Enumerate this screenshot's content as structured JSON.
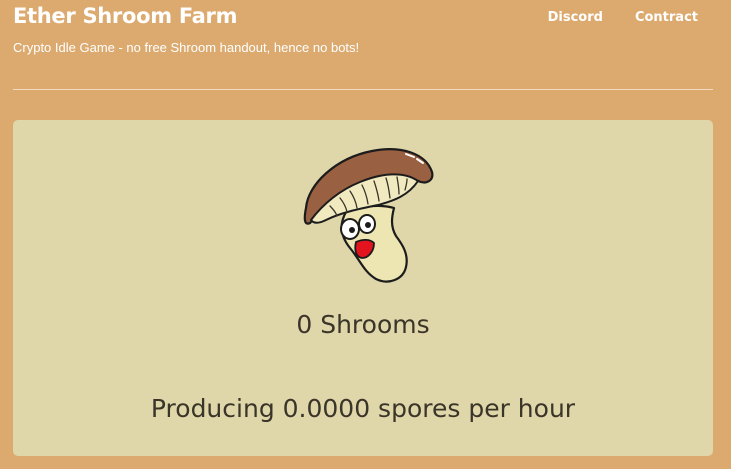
{
  "header": {
    "title": "Ether Shroom Farm",
    "subtitle": "Crypto Idle Game - no free Shroom handout, hence no bots!"
  },
  "nav": {
    "items": [
      {
        "label": "Discord"
      },
      {
        "label": "Contract"
      }
    ]
  },
  "main": {
    "mascot_icon": "mushroom-mascot-icon",
    "shroom_count": "0 Shrooms",
    "production": "Producing 0.0000 spores per hour"
  },
  "colors": {
    "page_background": "#dcaa6e",
    "card_background": "#dfd6aa",
    "header_text": "#ffffff",
    "body_text": "#3a3528"
  }
}
